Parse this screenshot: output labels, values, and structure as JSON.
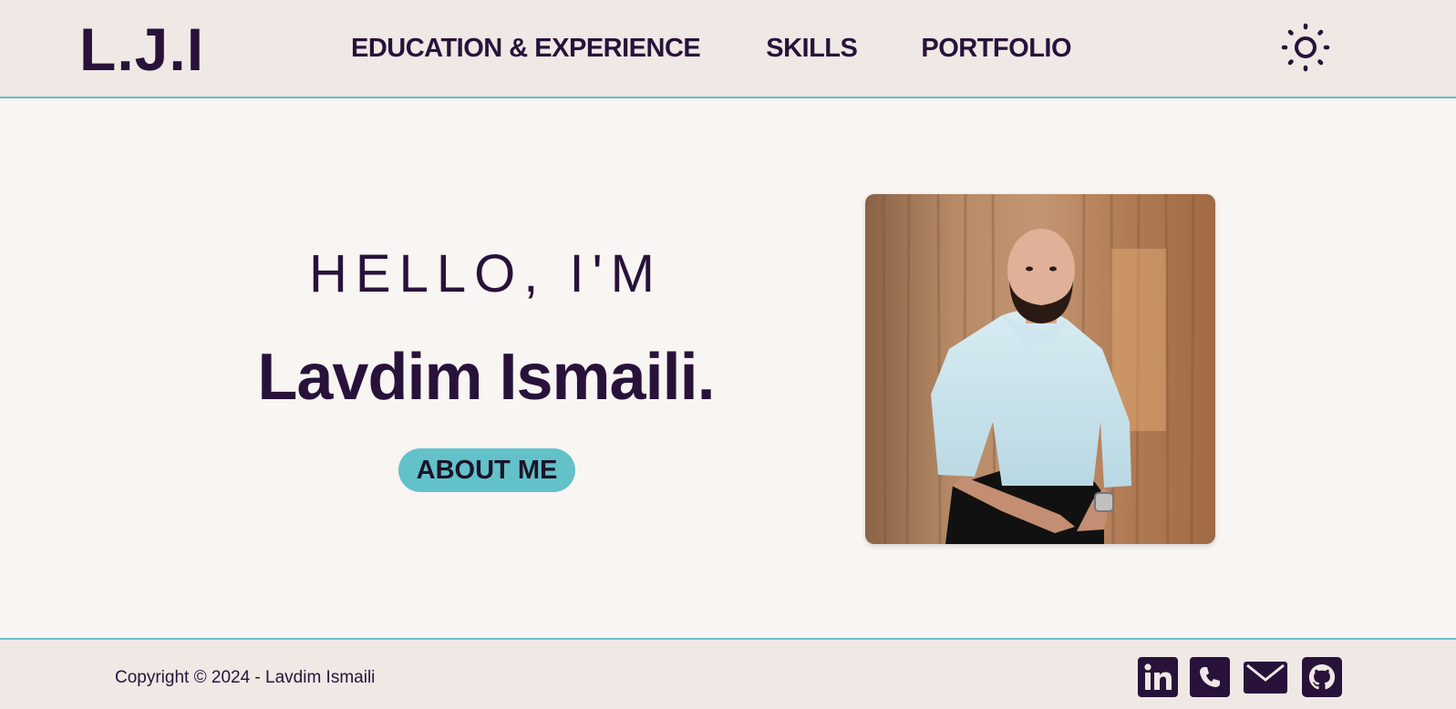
{
  "header": {
    "logo": "L.J.I",
    "nav": [
      {
        "label": "EDUCATION & EXPERIENCE"
      },
      {
        "label": "SKILLS"
      },
      {
        "label": "PORTFOLIO"
      }
    ],
    "theme_toggle_icon": "sun-icon"
  },
  "hero": {
    "greeting": "HELLO, I'M",
    "name": "Lavdim Ismaili.",
    "button_label": "ABOUT ME",
    "photo_icon": "profile-photo"
  },
  "footer": {
    "copyright": "Copyright © 2024 - Lavdim Ismaili",
    "social": [
      {
        "icon": "linkedin-icon"
      },
      {
        "icon": "phone-icon"
      },
      {
        "icon": "mail-icon"
      },
      {
        "icon": "github-icon"
      }
    ]
  },
  "colors": {
    "primary": "#28123a",
    "accent": "#63c1c9",
    "header_bg": "#efe8e5",
    "page_bg": "#f9f5f3"
  }
}
